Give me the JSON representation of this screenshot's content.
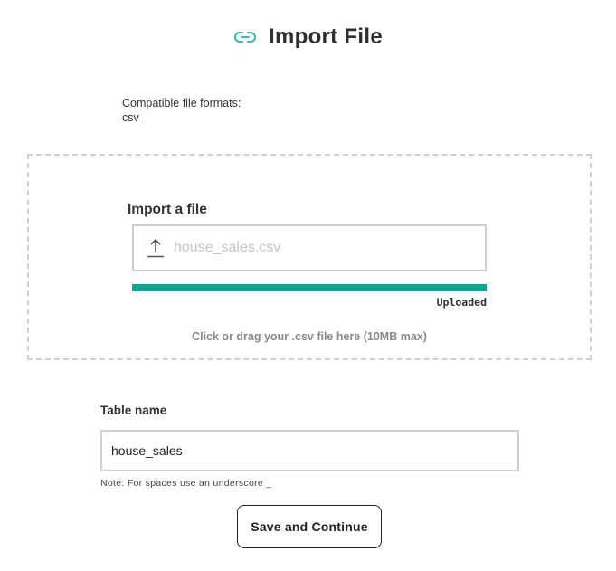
{
  "header": {
    "title": "Import File",
    "icon": "link-icon",
    "icon_color": "#3fb6a8"
  },
  "formats": {
    "label": "Compatible file formats:",
    "value": "csv"
  },
  "dropzone": {
    "label": "Import a file",
    "file_name": "house_sales.csv",
    "upload_icon": "upload-icon",
    "progress_fraction": 1.0,
    "progress_color": "#00a98f",
    "status": "Uploaded",
    "hint": "Click or drag your .csv file here (10MB max)"
  },
  "table": {
    "label": "Table name",
    "value": "house_sales",
    "note": "Note: For spaces use an underscore _"
  },
  "actions": {
    "save_label": "Save and Continue"
  }
}
